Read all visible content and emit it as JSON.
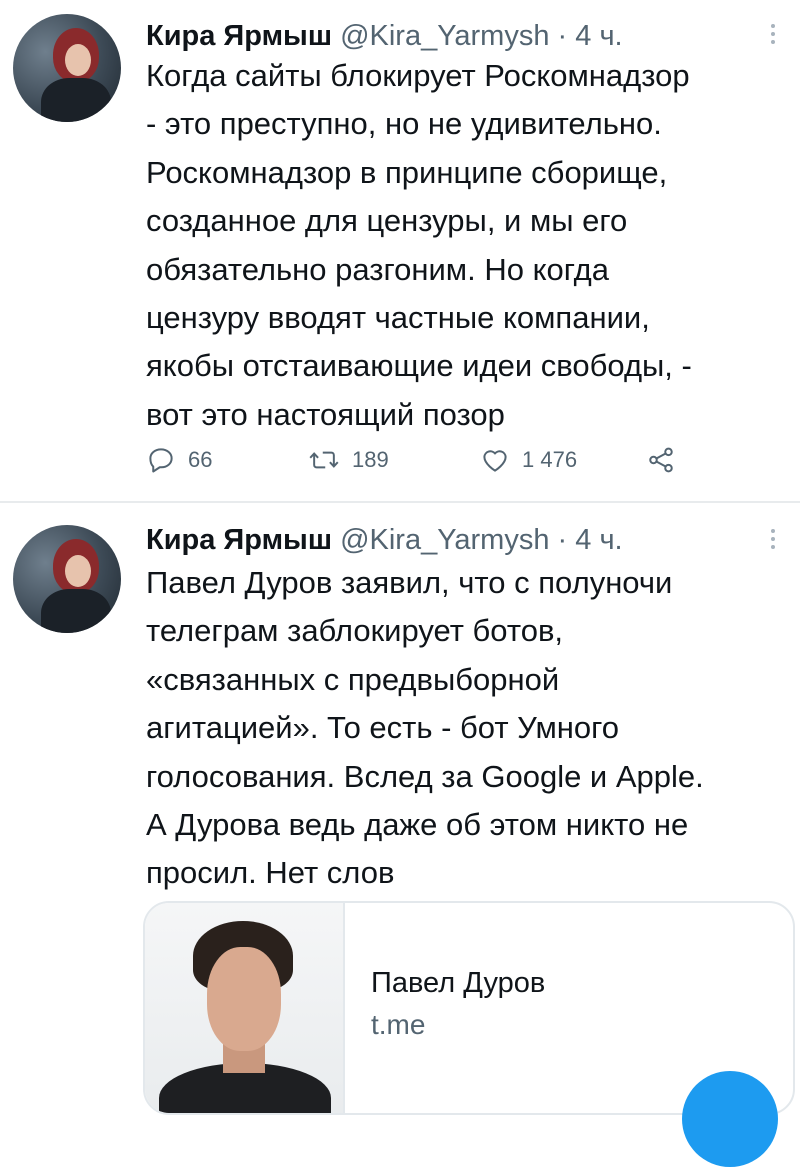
{
  "tweets": [
    {
      "author_name": "Кира Ярмыш",
      "handle": "@Kira_Yarmysh",
      "separator": "·",
      "time": "4 ч.",
      "text": "Когда сайты блокирует Роскомнадзор\n- это преступно, но не удивительно.\nРоскомнадзор в принципе сборище,\nсозданное для цензуры, и мы его\nобязательно разгоним. Но когда\nцензуру вводят частные компании,\nякобы отстаивающие идеи свободы, -\nвот это настоящий позор",
      "actions": {
        "replies": "66",
        "retweets": "189",
        "likes": "1 476"
      }
    },
    {
      "author_name": "Кира Ярмыш",
      "handle": "@Kira_Yarmysh",
      "separator": "·",
      "time": "4 ч.",
      "text": "Павел Дуров заявил, что с полуночи\nтелеграм заблокирует ботов,\n«связанных с предвыборной\nагитацией». То есть - бот Умного\nголосования. Вслед за Google и Apple.\nА Дурова ведь даже об этом никто не\nпросил. Нет слов",
      "card": {
        "title": "Павел Дуров",
        "domain": "t.me"
      }
    }
  ],
  "colors": {
    "text": "#0f1419",
    "secondary": "#536471",
    "divider": "#e8ebed",
    "accent": "#1d9bf0"
  },
  "icons": [
    "reply-icon",
    "retweet-icon",
    "like-icon",
    "share-icon",
    "more-icon",
    "compose-icon"
  ]
}
